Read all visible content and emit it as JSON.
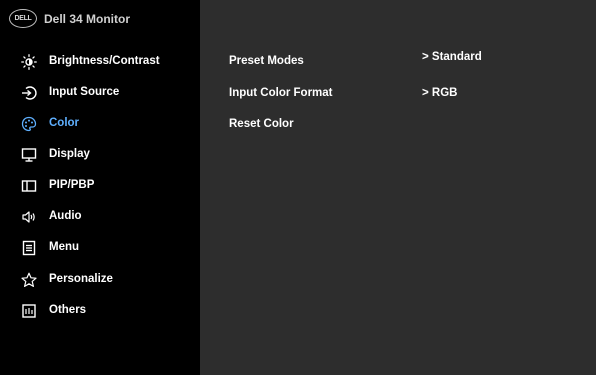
{
  "header": {
    "logo_text": "DELL",
    "model": "Dell 34 Monitor"
  },
  "nav": {
    "items": [
      {
        "label": "Brightness/Contrast",
        "icon": "brightness-icon"
      },
      {
        "label": "Input Source",
        "icon": "input-source-icon"
      },
      {
        "label": "Color",
        "icon": "color-palette-icon",
        "active": true
      },
      {
        "label": "Display",
        "icon": "display-icon"
      },
      {
        "label": "PIP/PBP",
        "icon": "pip-pbp-icon"
      },
      {
        "label": "Audio",
        "icon": "audio-icon"
      },
      {
        "label": "Menu",
        "icon": "menu-icon"
      },
      {
        "label": "Personalize",
        "icon": "star-icon"
      },
      {
        "label": "Others",
        "icon": "others-icon"
      }
    ]
  },
  "content": {
    "rows": [
      {
        "label": "Preset Modes",
        "value": "> Standard"
      },
      {
        "label": "Input Color Format",
        "value": "> RGB"
      },
      {
        "label": "Reset Color",
        "value": ""
      }
    ]
  },
  "colors": {
    "sidebar_bg": "#000000",
    "content_bg": "#2d2d2d",
    "active_text": "#5fb0ff",
    "text": "#ffffff"
  }
}
